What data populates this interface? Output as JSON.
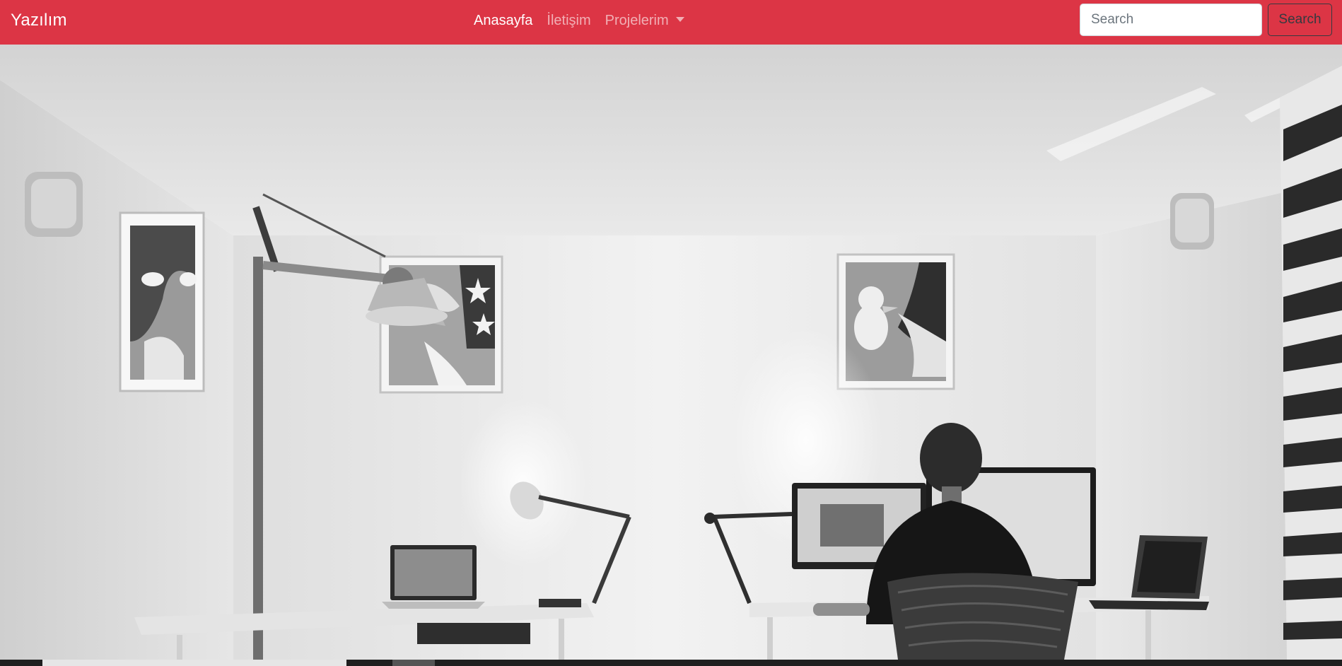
{
  "navbar": {
    "brand": "Yazılım",
    "links": [
      {
        "label": "Anasayfa",
        "active": true
      },
      {
        "label": "İletişim",
        "active": false
      },
      {
        "label": "Projelerim",
        "active": false,
        "dropdown": true
      }
    ],
    "search": {
      "placeholder": "Search",
      "button_label": "Search"
    },
    "colors": {
      "background": "#dc3545",
      "active_link": "#ffffff",
      "inactive_link": "rgba(255,255,255,0.6)",
      "button_border": "#343a40"
    }
  },
  "hero": {
    "style": "grayscale"
  }
}
